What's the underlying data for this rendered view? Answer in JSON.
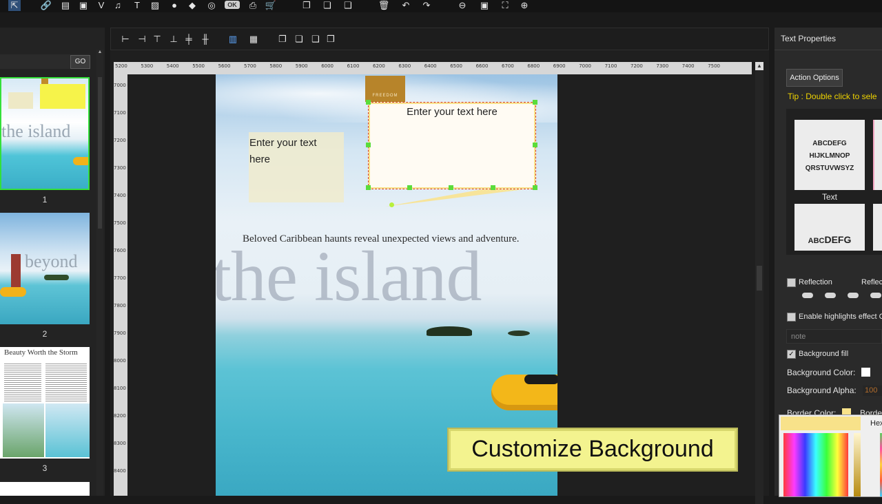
{
  "left_panel": {
    "go_label": "GO",
    "pages": [
      {
        "number": "1",
        "headline": "the island"
      },
      {
        "number": "2",
        "headline": "beyond"
      },
      {
        "number": "3",
        "headline": "Beauty Worth the Storm"
      }
    ]
  },
  "ruler": {
    "top_labels": [
      "5200",
      "5300",
      "5400",
      "5500",
      "5600",
      "5700",
      "5800",
      "5900",
      "6000",
      "6100",
      "6200",
      "6300",
      "6400",
      "6500",
      "6600",
      "6700",
      "6800",
      "6900",
      "7000",
      "7100",
      "7200",
      "7300",
      "7400",
      "7500"
    ],
    "left_labels": [
      "7000",
      "7100",
      "7200",
      "7300",
      "7400",
      "7500",
      "7600",
      "7700",
      "7800",
      "7900",
      "8000",
      "8100",
      "8200",
      "8300",
      "8400"
    ]
  },
  "page": {
    "tab_label": "FREEDOM",
    "textbox_left": "Enter your text here",
    "textbox_callout": "Enter your text here",
    "subtitle": "Beloved Caribbean haunts reveal unexpected views and adventure.",
    "headline": "the island"
  },
  "banner": {
    "text": "Customize Background"
  },
  "right_panel": {
    "title": "Text Properties",
    "action_options": "Action Options",
    "tip": "Tip : Double click to sele",
    "preset1_text": "ABCDEFG HIJKLMNOP QRSTUVWSYZ",
    "preset1_label": "Text",
    "preset2_small": "ABC",
    "preset2_big": "DEFG",
    "reflection": "Reflection",
    "reflection_right": "Reflec",
    "highlights": "Enable highlights effect C",
    "note_placeholder": "note",
    "background_fill": "Background fill",
    "background_color": "Background Color:",
    "background_alpha": "Background Alpha:",
    "background_alpha_value": "100",
    "border_color": "Border Color:",
    "border_right": "Borde",
    "hex_label": "Hex",
    "background_fill_checked": true
  }
}
